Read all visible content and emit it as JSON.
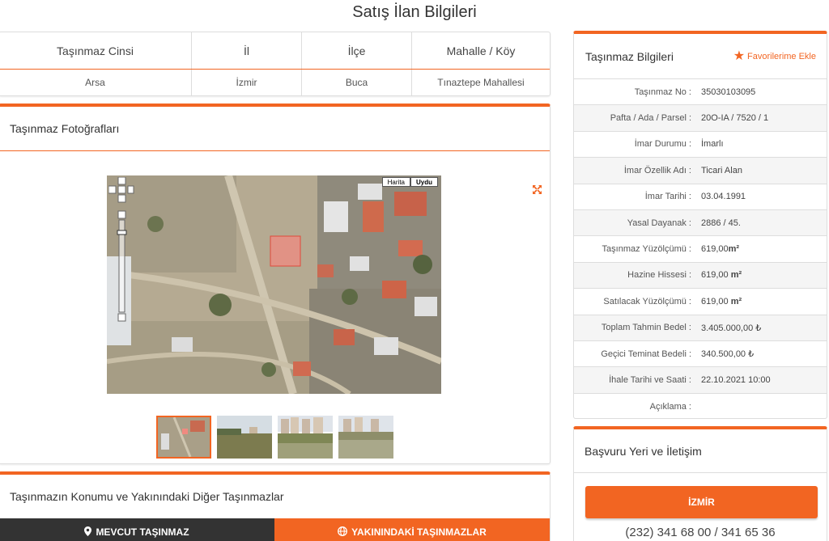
{
  "page_title": "Satış İlan Bilgileri",
  "info_table": {
    "headers": [
      "Taşınmaz Cinsi",
      "İl",
      "İlçe",
      "Mahalle / Köy"
    ],
    "values": [
      "Arsa",
      "İzmir",
      "Buca",
      "Tınaztepe Mahallesi"
    ]
  },
  "photos": {
    "title": "Taşınmaz Fotoğrafları",
    "expand_icon": "expand-icon",
    "map_buttons": [
      "Harita",
      "Uydu"
    ],
    "thumbnails": [
      "map-thumbnail",
      "photo-field",
      "photo-buildings",
      "photo-empty-lot"
    ]
  },
  "location": {
    "title": "Taşınmazın Konumu ve Yakınındaki Diğer Taşınmazlar",
    "tab_current": "MEVCUT TAŞINMAZ",
    "tab_nearby": "YAKININDAKİ TAŞINMAZLAR"
  },
  "details": {
    "title": "Taşınmaz Bilgileri",
    "favorite_label": "Favorilerime Ekle",
    "rows": [
      {
        "label": "Taşınmaz No :",
        "value": "35030103095"
      },
      {
        "label": "Pafta / Ada / Parsel :",
        "value": "20O-IA / 7520 / 1"
      },
      {
        "label": "İmar Durumu :",
        "value": "İmarlı"
      },
      {
        "label": "İmar Özellik Adı :",
        "value": "Ticari Alan"
      },
      {
        "label": "İmar Tarihi :",
        "value": "03.04.1991"
      },
      {
        "label": "Yasal Dayanak :",
        "value": "2886 / 45."
      },
      {
        "label": "Taşınmaz Yüzölçümü :",
        "value": "619,00",
        "unit": "m²"
      },
      {
        "label": "Hazine Hissesi :",
        "value": "619,00",
        "unit": "m²"
      },
      {
        "label": "Satılacak Yüzölçümü :",
        "value": "619,00",
        "unit": "m²"
      },
      {
        "label": "Toplam Tahmin Bedel :",
        "value": "3.405.000,00 ₺"
      },
      {
        "label": "Geçici Teminat Bedeli :",
        "value": "340.500,00 ₺"
      },
      {
        "label": "İhale Tarihi ve Saati :",
        "value": "22.10.2021 10:00"
      },
      {
        "label": "Açıklama :",
        "value": ""
      }
    ]
  },
  "contact": {
    "title": "Başvuru Yeri ve İletişim",
    "city_button": "İZMİR",
    "phone": "(232) 341 68 00 / 341 65 36"
  },
  "colors": {
    "accent": "#f26522",
    "dark_tab": "#333333"
  }
}
